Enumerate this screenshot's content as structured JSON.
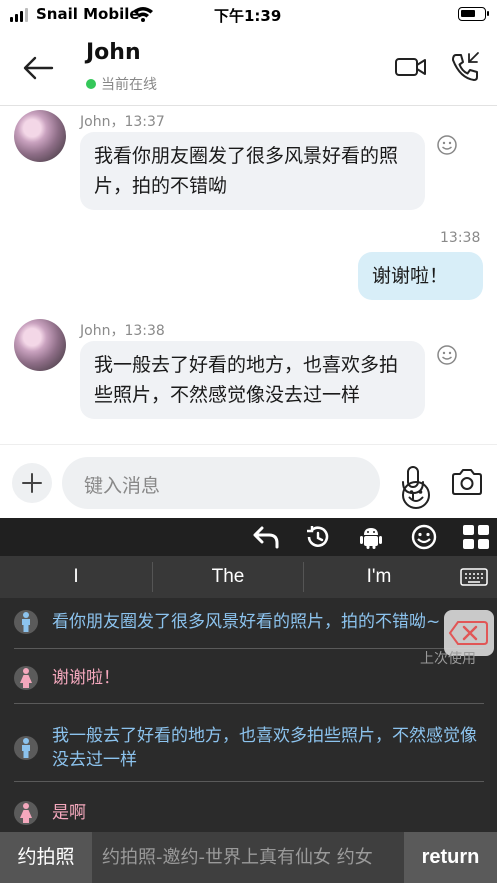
{
  "status_bar": {
    "carrier": "Snail Mobile",
    "time": "下午1:39"
  },
  "header": {
    "contact_name": "John",
    "presence": "当前在线"
  },
  "messages": [
    {
      "direction": "in",
      "meta": "John，13:37",
      "text": "我看你朋友圈发了很多风景好看的照片，拍的不错呦"
    },
    {
      "direction": "out",
      "meta": "13:38",
      "text": "谢谢啦！"
    },
    {
      "direction": "in",
      "meta": "John，13:38",
      "text": "我一般去了好看的地方，也喜欢多拍些照片，不然感觉像没去过一样"
    }
  ],
  "input": {
    "placeholder": "键入消息"
  },
  "keyboard": {
    "candidates": [
      "I",
      "The",
      "I'm"
    ],
    "phrases": [
      {
        "role": "male",
        "text": "看你朋友圈发了很多风景好看的照片，拍的不错呦~"
      },
      {
        "role": "female",
        "text": "谢谢啦！"
      },
      {
        "role": "male",
        "text": "我一般去了好看的地方，也喜欢多拍些照片，不然感觉像没去过一样"
      },
      {
        "role": "female",
        "text": "是啊"
      }
    ],
    "last_used_label": "上次使用",
    "bottom_primary": "约拍照",
    "bottom_suggestions": "约拍照-邀约-世界上真有仙女   约女",
    "return_label": "return"
  },
  "colors": {
    "presence_online": "#34c759",
    "incoming_bubble": "#f0f2f5",
    "outgoing_bubble": "#d8eef8",
    "keyboard_bg": "#2b2b2b",
    "male_phrase": "#8cc3ee",
    "female_phrase": "#f4a8bd"
  }
}
